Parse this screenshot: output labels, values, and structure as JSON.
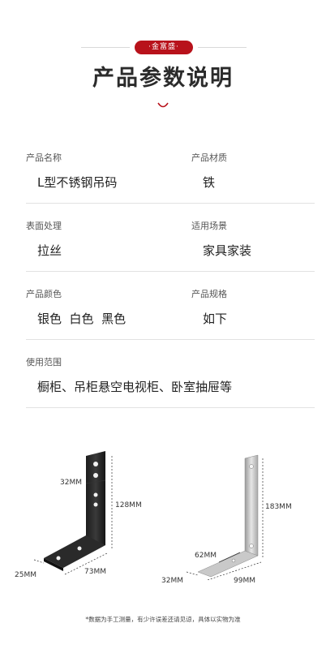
{
  "header": {
    "brand": "·金富盛·",
    "title": "产品参数说明"
  },
  "params": {
    "name_label": "产品名称",
    "name_value": "L型不锈钢吊码",
    "material_label": "产品材质",
    "material_value": "铁",
    "surface_label": "表面处理",
    "surface_value": "拉丝",
    "scene_label": "适用场景",
    "scene_value": "家具家装",
    "color_label": "产品颜色",
    "color_value": "银色  白色  黑色",
    "spec_label": "产品规格",
    "spec_value": "如下",
    "usage_label": "使用范围",
    "usage_value": "橱柜、吊柜悬空电视柜、卧室抽屉等"
  },
  "dimensions": {
    "black": {
      "width": "32MM",
      "height": "128MM",
      "depth": "25MM",
      "length": "73MM"
    },
    "silver": {
      "height": "183MM",
      "inner": "62MM",
      "width": "32MM",
      "length": "99MM"
    }
  },
  "footer": {
    "note": "*数据为手工测量，有少许误差还请见谅，具体以实物为准"
  },
  "colors": {
    "accent": "#b8121b",
    "divider": "#e2e2e2"
  }
}
